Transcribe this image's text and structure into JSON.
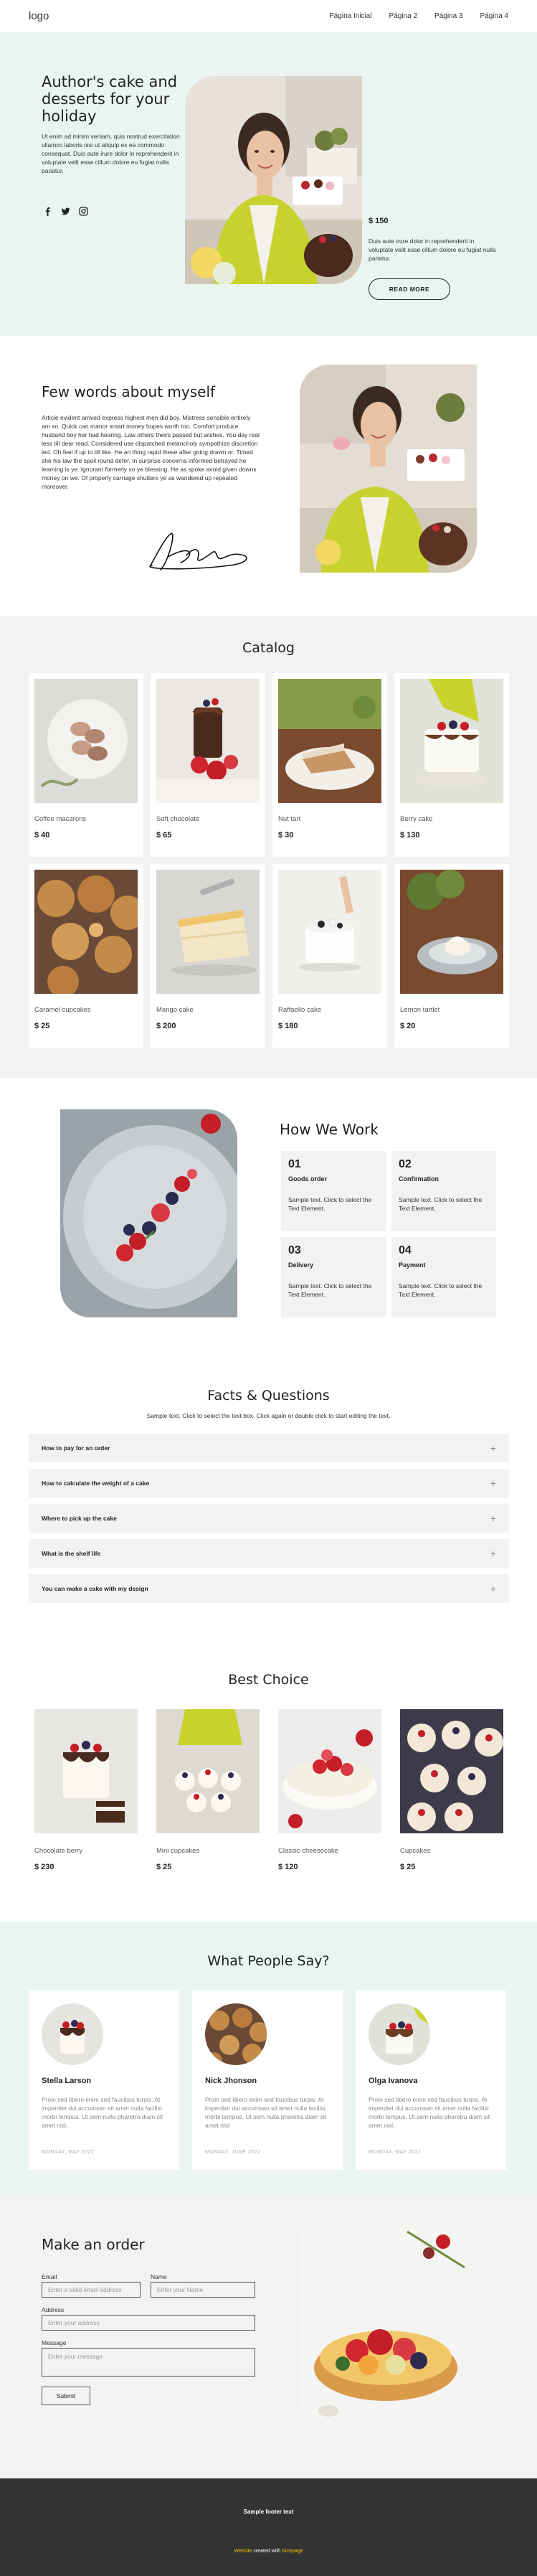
{
  "header": {
    "logo": "logo",
    "nav": [
      "Página Inicial",
      "Página 2",
      "Página 3",
      "Página 4"
    ]
  },
  "hero": {
    "title": "Author's cake and desserts for your holiday",
    "intro": "Ut enim ad minim veniam, quis nostrud exercitation ullamco laboris nisi ut aliquip ex ea commodo consequat. Duis aute irure dolor in reprehenderit in voluptate velit esse cillum dolore eu fugiat nulla pariatur.",
    "social": [
      "facebook-icon",
      "twitter-icon",
      "instagram-icon"
    ],
    "price": "$ 150",
    "side_text": "Duis aute irure dolor in reprehenderit in voluptate velit esse cillum dolore eu fugiat nulla pariatur.",
    "button": "READ MORE"
  },
  "about": {
    "title": "Few words about myself",
    "text": "Article evident arrived express highest men did boy. Mistress sensible entirely am so. Quick can manor smart money hopes worth too. Comfort produce husband boy her had hearing. Law others theirs passed but wishes. You day real less till dear read. Considered use dispatched melancholy sympathize discretion led. Oh feel if up to till like. He an thing rapid these after going drawn or. Timed she his law the spoil round defer. In surprise concerns informed betrayed he learning is ye. Ignorant formerly so ye blessing. He as spoke avoid given downs money on we. Of properly carriage shutters ye as wandered up repeated moreover."
  },
  "catalog": {
    "title": "Catalog",
    "items": [
      {
        "name": "Coffee macarons",
        "price": "$ 40"
      },
      {
        "name": "Soft chocolate",
        "price": "$ 65"
      },
      {
        "name": "Nut tart",
        "price": "$ 30"
      },
      {
        "name": "Berry cake",
        "price": "$ 130"
      },
      {
        "name": "Caramel cupcakes",
        "price": "$ 25"
      },
      {
        "name": "Mango cake",
        "price": "$ 200"
      },
      {
        "name": "Raffaello cake",
        "price": "$ 180"
      },
      {
        "name": "Lemon tartlet",
        "price": "$ 20"
      }
    ]
  },
  "how": {
    "title": "How We Work",
    "steps": [
      {
        "num": "01",
        "title": "Goods order",
        "text": "Sample text. Click to select the Text Element."
      },
      {
        "num": "02",
        "title": "Confirmation",
        "text": "Sample text. Click to select the Text Element."
      },
      {
        "num": "03",
        "title": "Delivery",
        "text": "Sample text. Click to select the Text Element."
      },
      {
        "num": "04",
        "title": "Payment",
        "text": "Sample text. Click to select the Text Element."
      }
    ]
  },
  "faq": {
    "title": "Facts & Questions",
    "subtitle": "Sample text. Click to select the text box. Click again or double click to start editing the text.",
    "items": [
      "How to pay for an order",
      "How to calculate the weight of a cake",
      "Where to pick up the cake",
      "What is the shelf life",
      "You can make a cake with my design"
    ]
  },
  "best": {
    "title": "Best Choice",
    "items": [
      {
        "name": "Chocolate berry",
        "price": "$ 230"
      },
      {
        "name": "Mini cupcakes",
        "price": "$ 25"
      },
      {
        "name": "Classic cheesecake",
        "price": "$ 120"
      },
      {
        "name": "Cupcakes",
        "price": "$ 25"
      }
    ]
  },
  "testimonials": {
    "title": "What People Say?",
    "items": [
      {
        "name": "Stella Larson",
        "text": "Proin sed libero enim sed faucibus turpis. At imperdiet dui accumsan sit amet nulla facilisi morbi tempus. Ut sem nulla pharetra diam sit amet nisl.",
        "date": "MONDAY, MAY 2022"
      },
      {
        "name": "Nick Jhonson",
        "text": "Proin sed libero enim sed faucibus turpis. At imperdiet dui accumsan sit amet nulla facilisi morbi tempus. Ut sem nulla pharetra diam sit amet nisl.",
        "date": "MONDAY, JUNE 2022"
      },
      {
        "name": "Olga Ivanova",
        "text": "Proin sed libero enim sed faucibus turpis. At imperdiet dui accumsan sit amet nulla facilisi morbi tempus. Ut sem nulla pharetra diam sit amet nisl.",
        "date": "MONDAY, MAY 2022"
      }
    ]
  },
  "order": {
    "title": "Make an order",
    "email_label": "Email",
    "email_placeholder": "Enter a valid email address",
    "name_label": "Name",
    "name_placeholder": "Enter your Name",
    "address_label": "Address",
    "address_placeholder": "Enter your address",
    "message_label": "Message",
    "message_placeholder": "Enter your message",
    "submit": "Submit"
  },
  "footer": {
    "text": "Sample footer text",
    "credit_prefix": "Website",
    "credit_mid": " created with ",
    "credit_suffix": "Nicepage"
  },
  "colors": {
    "mint": "#eaf5f1",
    "light_gray": "#f2f2f2",
    "footer_bg": "#333333",
    "accent_yellow": "#f5c400"
  }
}
